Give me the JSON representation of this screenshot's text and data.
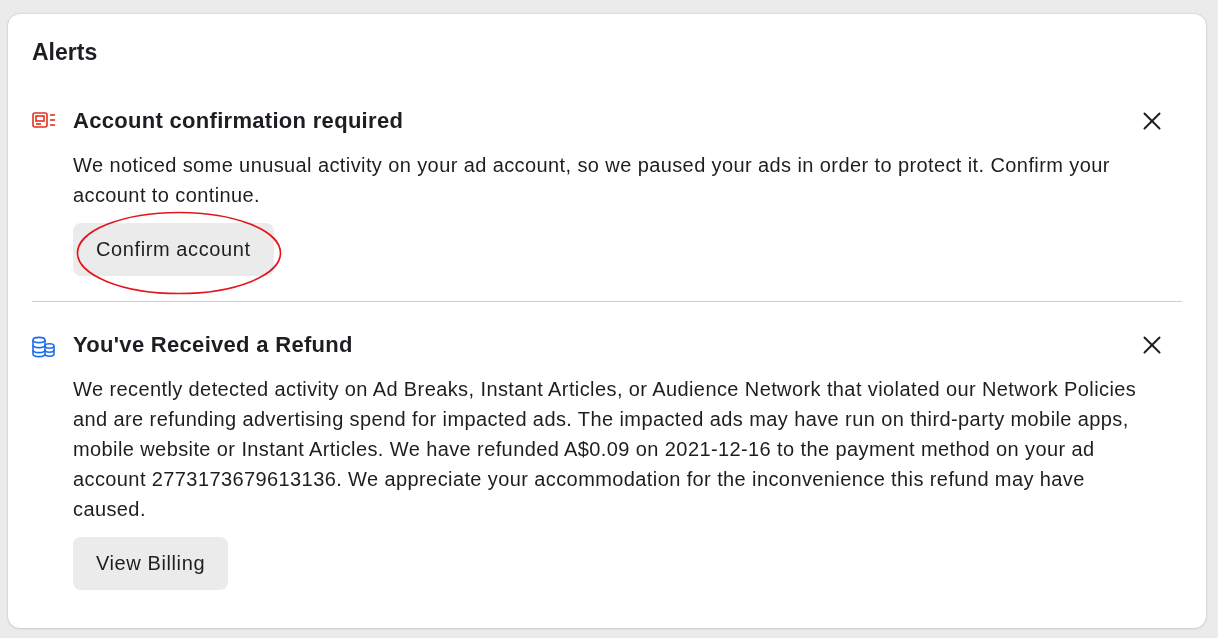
{
  "panel": {
    "title": "Alerts"
  },
  "alerts": [
    {
      "kind": "account",
      "title": "Account confirmation required",
      "body": "We noticed some unusual activity on your ad account, so we paused your ads in order to protect it. Confirm your account to continue.",
      "button": {
        "label": "Confirm account",
        "circled": true
      }
    },
    {
      "kind": "refund",
      "title": "You've Received a Refund",
      "body": "We recently detected activity on Ad Breaks, Instant Articles, or Audience Network that violated our Network Policies and are refunding advertising spend for impacted ads. The impacted ads may have run on third-party mobile apps, mobile website or Instant Articles. We have refunded A$0.09 on 2021-12-16 to the payment method on your ad account 2773173679613136. We appreciate your accommodation for the inconvenience this refund may have caused.",
      "button": {
        "label": "View Billing",
        "circled": false
      }
    }
  ]
}
